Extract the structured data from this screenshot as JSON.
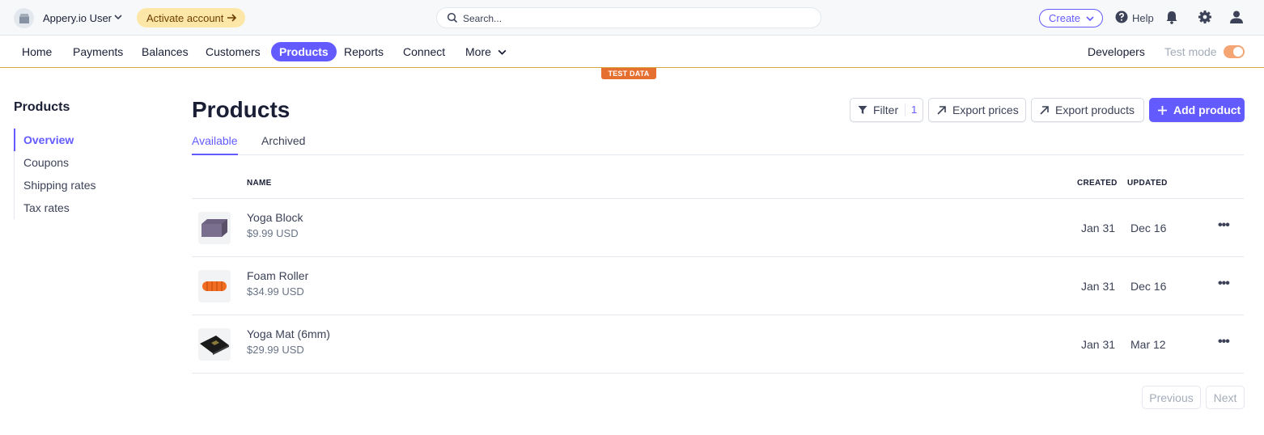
{
  "topbar": {
    "account_name": "Appery.io User",
    "activate_label": "Activate account",
    "search_placeholder": "Search...",
    "create_label": "Create",
    "help_label": "Help"
  },
  "nav": {
    "items": [
      "Home",
      "Payments",
      "Balances",
      "Customers",
      "Products",
      "Reports",
      "Connect",
      "More"
    ],
    "active": "Products",
    "developers_label": "Developers",
    "test_mode_label": "Test mode",
    "test_mode_on": true,
    "test_data_badge": "TEST DATA"
  },
  "sidebar": {
    "title": "Products",
    "items": [
      {
        "label": "Overview",
        "active": true
      },
      {
        "label": "Coupons"
      },
      {
        "label": "Shipping rates"
      },
      {
        "label": "Tax rates"
      }
    ]
  },
  "main": {
    "title": "Products",
    "filter_label": "Filter",
    "filter_count": "1",
    "export_prices_label": "Export prices",
    "export_products_label": "Export products",
    "add_product_label": "Add product",
    "tabs": [
      {
        "label": "Available",
        "active": true
      },
      {
        "label": "Archived"
      }
    ],
    "columns": {
      "name": "NAME",
      "created": "CREATED",
      "updated": "UPDATED"
    },
    "rows": [
      {
        "name": "Yoga Block",
        "price": "$9.99 USD",
        "created": "Jan 31",
        "updated": "Dec 16",
        "thumb": "yoga-block"
      },
      {
        "name": "Foam Roller",
        "price": "$34.99 USD",
        "created": "Jan 31",
        "updated": "Dec 16",
        "thumb": "foam-roller"
      },
      {
        "name": "Yoga Mat (6mm)",
        "price": "$29.99 USD",
        "created": "Jan 31",
        "updated": "Mar 12",
        "thumb": "yoga-mat"
      }
    ],
    "pagination": {
      "previous_label": "Previous",
      "next_label": "Next"
    }
  },
  "colors": {
    "accent": "#635bff",
    "activate_bg": "#fde7a8",
    "test_badge": "#e56f2f"
  }
}
